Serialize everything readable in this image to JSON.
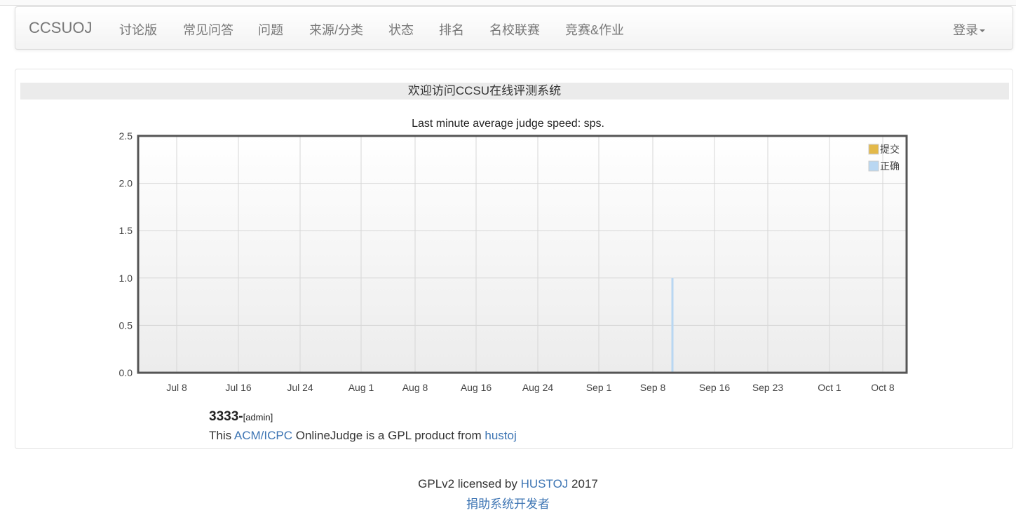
{
  "nav": {
    "brand": "CCSUOJ",
    "items": [
      "讨论版",
      "常见问答",
      "问题",
      "来源/分类",
      "状态",
      "排名",
      "名校联赛",
      "竞赛&作业"
    ],
    "login": "登录"
  },
  "welcome": "欢迎访问CCSU在线评测系统",
  "chart_data": {
    "type": "line",
    "title": "Last minute average judge speed: sps.",
    "x_ticks": [
      "Jul 8",
      "Jul 16",
      "Jul 24",
      "Aug 1",
      "Aug 8",
      "Aug 16",
      "Aug 24",
      "Sep 1",
      "Sep 8",
      "Sep 16",
      "Sep 23",
      "Oct 1",
      "Oct 8"
    ],
    "y_ticks": [
      "2.5",
      "2.0",
      "1.5",
      "1.0",
      "0.5",
      "0.0"
    ],
    "ylim": [
      0,
      2.5
    ],
    "grid": true,
    "legend_position": "top-right",
    "series": [
      {
        "name": "提交",
        "color": "#e3b94a",
        "points": []
      },
      {
        "name": "正确",
        "color": "#b9d7f2",
        "points": [
          {
            "x": "Sep 10",
            "y": 1.0
          }
        ]
      }
    ]
  },
  "news": {
    "title": "3333-",
    "tag": "[admin]",
    "line_prefix": "This ",
    "link1": "ACM/ICPC",
    "line_middle": " OnlineJudge is a GPL product from ",
    "link2": "hustoj"
  },
  "footer": {
    "prefix": "GPLv2 licensed by ",
    "link": "HUSTOJ",
    "suffix": " 2017",
    "donate": "捐助系统开发者"
  }
}
